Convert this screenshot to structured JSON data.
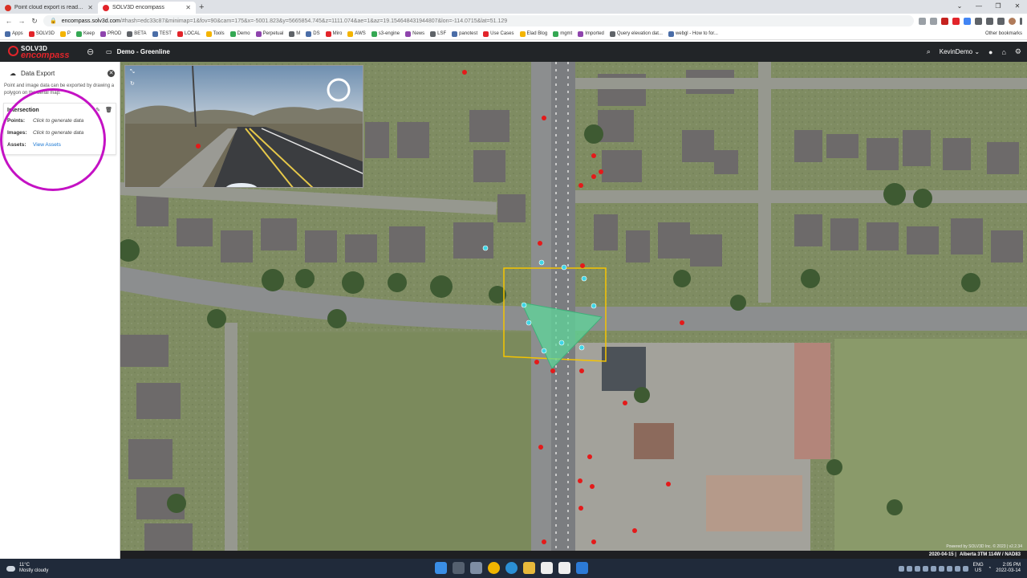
{
  "browser": {
    "tabs": [
      {
        "title": "Point cloud export is ready for d",
        "icon": "gmail-icon",
        "color": "#d93025"
      },
      {
        "title": "SOLV3D encompass",
        "icon": "solv3d-favicon-icon",
        "color": "#e2242a"
      }
    ],
    "new_tab": "+",
    "url_host": "encompass.solv3d.com",
    "url_path": "/#hash=edc33c87&minimap=1&fov=90&cam=175&x=-5001.823&y=5665854.745&z=1111.074&ae=1&az=19.154648431944807&lon=-114.0715&lat=51.129",
    "bookmarks": [
      "Apps",
      "SOLV3D",
      "P",
      "Keep",
      "PROD",
      "BETA",
      "TEST",
      "LOCAL",
      "Tools",
      "Demo",
      "Perpetual",
      "M",
      "DS",
      "Miro",
      "AWS",
      "s3-engine",
      "News",
      "LSF",
      "panotest",
      "Use Cases",
      "Elad Blog",
      "mgmt",
      "Imported",
      "Query elevation dat...",
      "webgl - How to for..."
    ],
    "other_bookmarks": "Other bookmarks"
  },
  "app": {
    "logo_top": "SOLV3D",
    "logo_bottom": "encompass",
    "project": "Demo - Greenline",
    "user": "KevinDemo"
  },
  "panel": {
    "title": "Data Export",
    "description": "Point and image data can be exported by drawing a polygon on the aerial map.",
    "card_title": "Intersection",
    "rows": [
      {
        "label": "Points:",
        "value": "Click to generate data"
      },
      {
        "label": "Images:",
        "value": "Click to generate data"
      },
      {
        "label": "Assets:",
        "value": "View Assets"
      }
    ]
  },
  "map": {
    "credits": "Powered by SOLV3D Inc. © 2023 | v2.2.34",
    "date": "2020-04-15 |",
    "crs": "Alberta 3TM 114W / NAD83"
  },
  "taskbar": {
    "temp": "11°C",
    "weather": "Mostly cloudy",
    "lang1": "ENG",
    "lang2": "US",
    "time": "2:05 PM",
    "date": "2022-03-14"
  },
  "colors": {
    "accent": "#e2242a",
    "highlight": "#c412c4",
    "polygon_fill": "#5ed69a",
    "polygon_edge": "#f5c400",
    "link": "#1976d2"
  }
}
